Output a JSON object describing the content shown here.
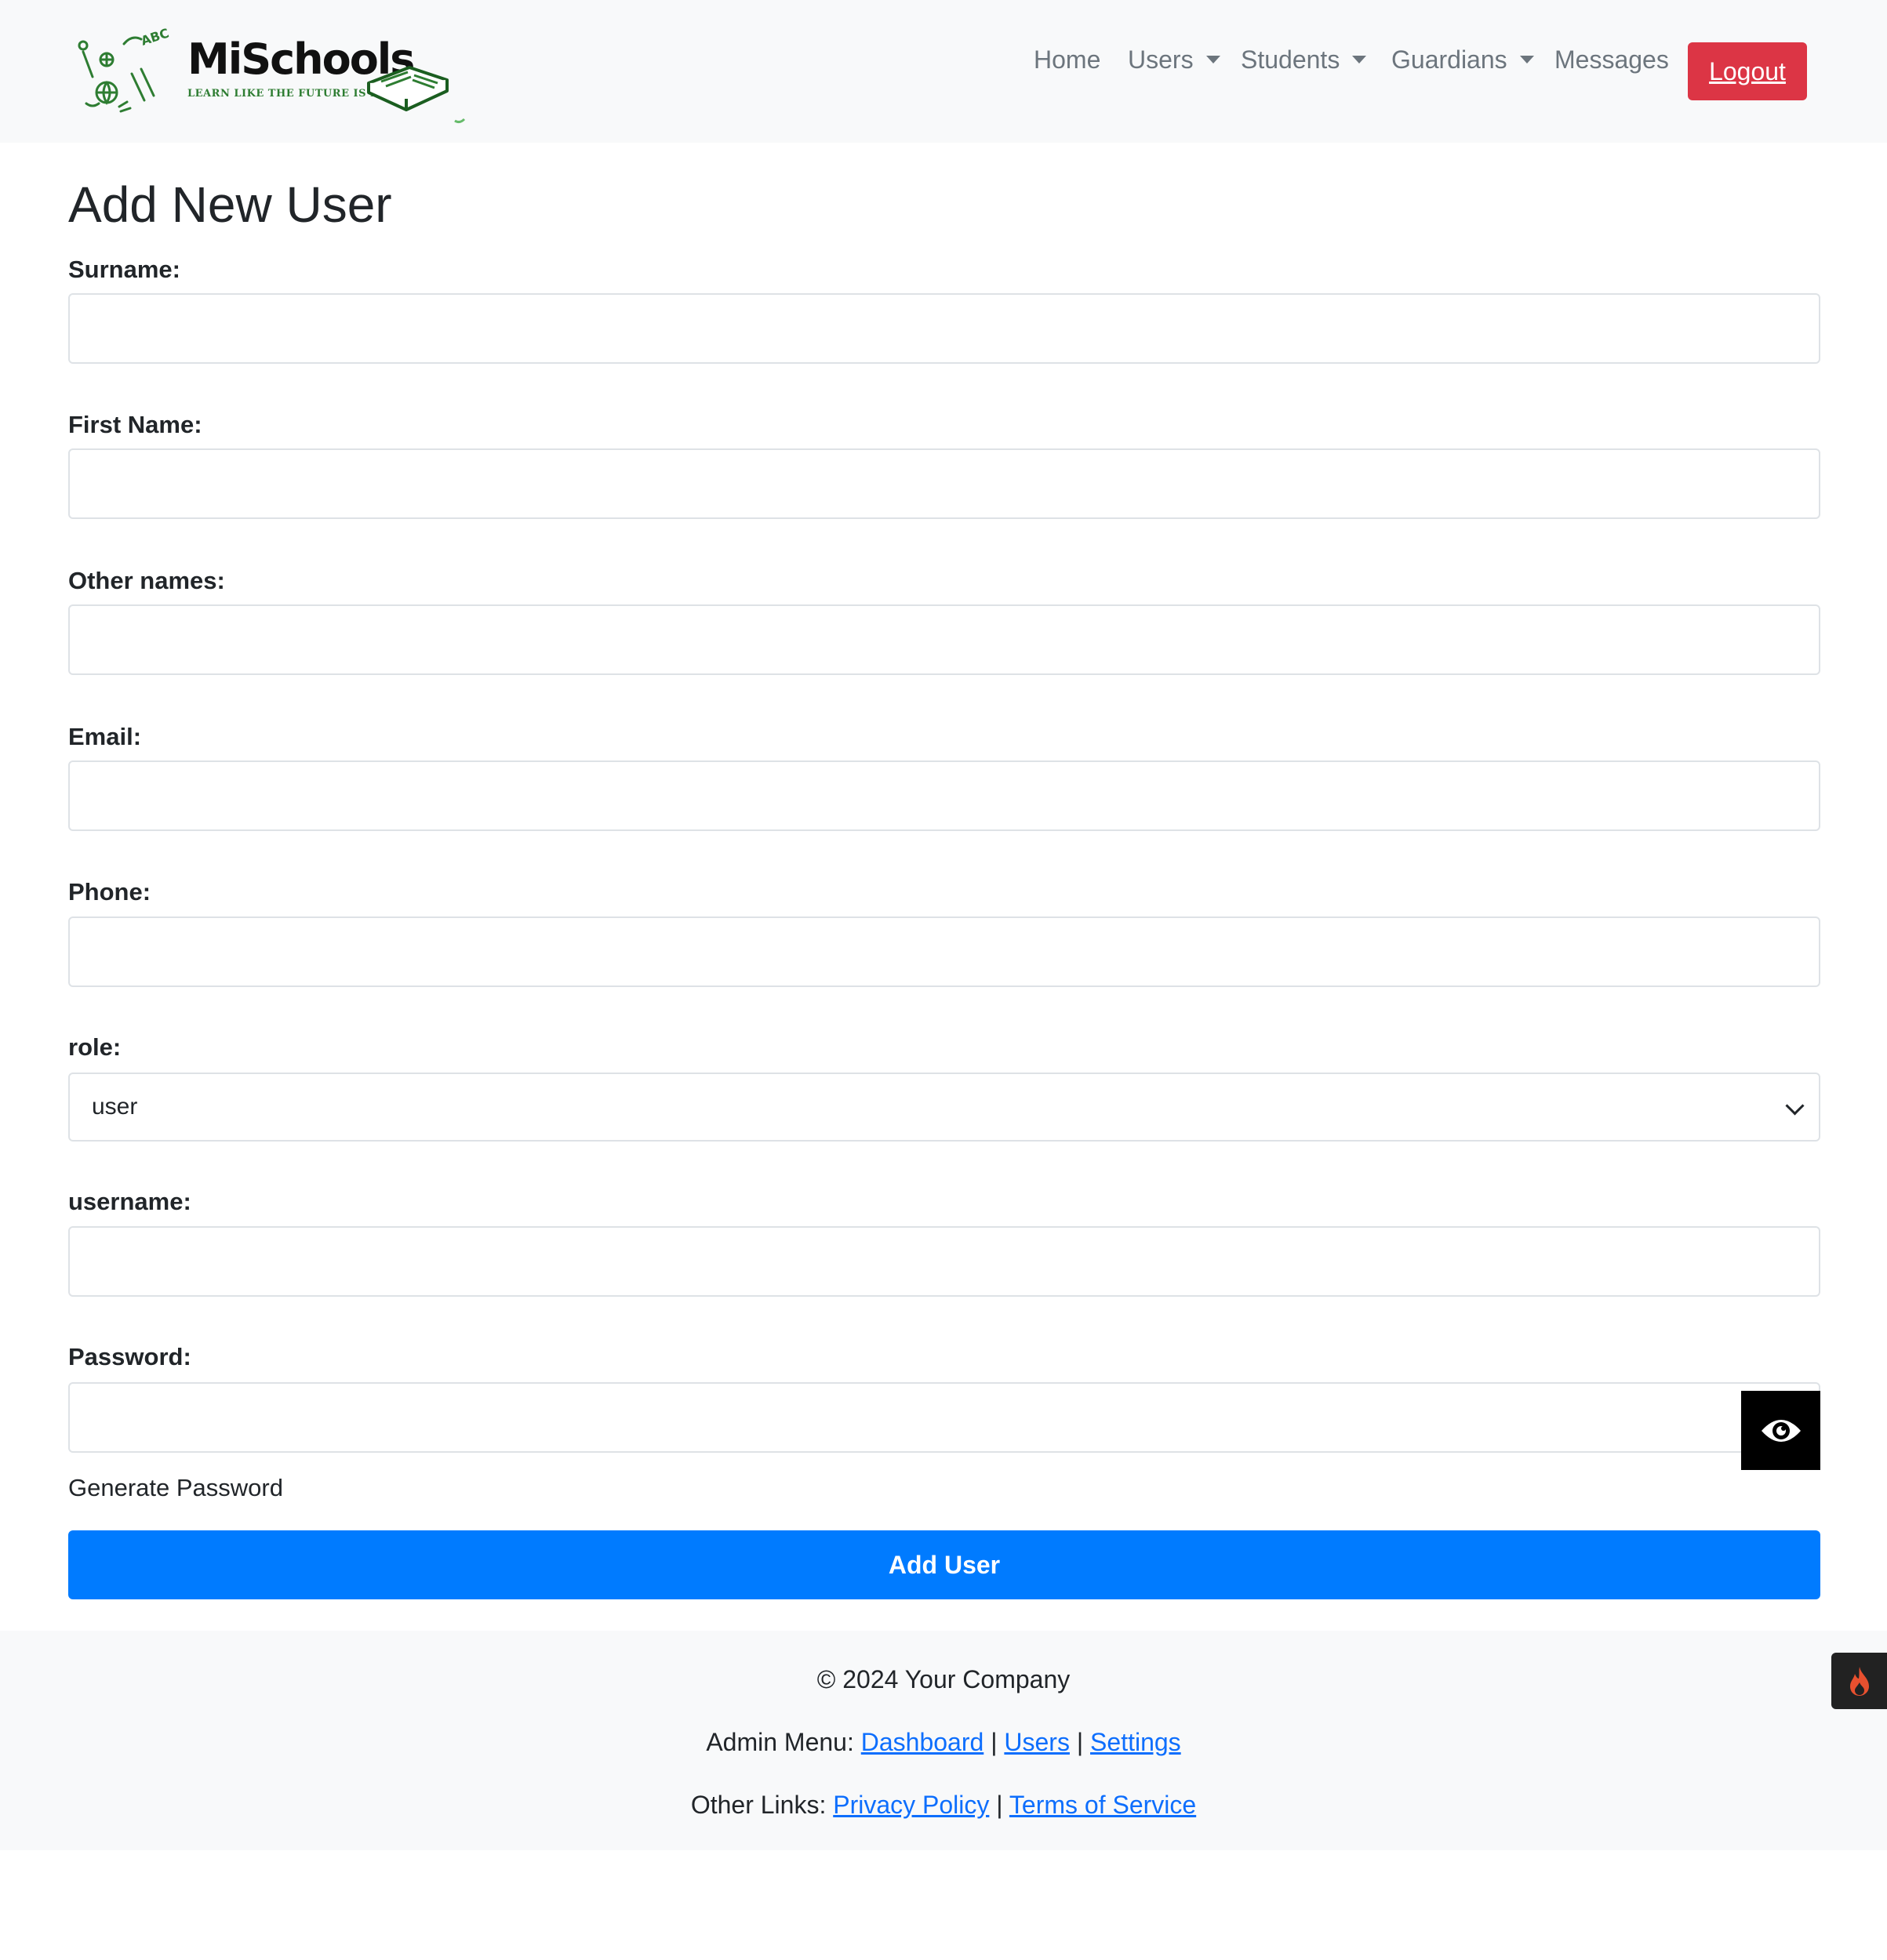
{
  "brand": {
    "name": "MiSchools",
    "tagline": "LEARN LIKE THE FUTURE IS NOW",
    "colors": {
      "primary_green": "#2e7d32",
      "text": "#111111"
    }
  },
  "nav": {
    "items": [
      {
        "label": "Home",
        "dropdown": false
      },
      {
        "label": "Users",
        "dropdown": true
      },
      {
        "label": "Students",
        "dropdown": true
      },
      {
        "label": "Guardians",
        "dropdown": true
      },
      {
        "label": "Messages",
        "dropdown": false
      }
    ],
    "logout_label": "Logout",
    "logout_color": "#dc3545"
  },
  "form": {
    "title": "Add New User",
    "fields": {
      "surname": {
        "label": "Surname:",
        "value": ""
      },
      "first_name": {
        "label": "First Name:",
        "value": ""
      },
      "other_names": {
        "label": "Other names:",
        "value": ""
      },
      "email": {
        "label": "Email:",
        "value": ""
      },
      "phone": {
        "label": "Phone:",
        "value": ""
      },
      "role": {
        "label": "role:",
        "selected": "user"
      },
      "username": {
        "label": "username:",
        "value": ""
      },
      "password": {
        "label": "Password:",
        "value": ""
      }
    },
    "password_toggle_icon": "eye-icon",
    "generate_password_label": "Generate Password",
    "submit_label": "Add User",
    "submit_color": "#007bff"
  },
  "footer": {
    "copyright": "© 2024 Your Company",
    "admin_menu_label": "Admin Menu:",
    "admin_links": [
      "Dashboard",
      "Users",
      "Settings"
    ],
    "other_links_label": "Other Links:",
    "other_links": [
      "Privacy Policy",
      "Terms of Service"
    ],
    "separator": "|",
    "widget_icon": "fire-icon"
  }
}
